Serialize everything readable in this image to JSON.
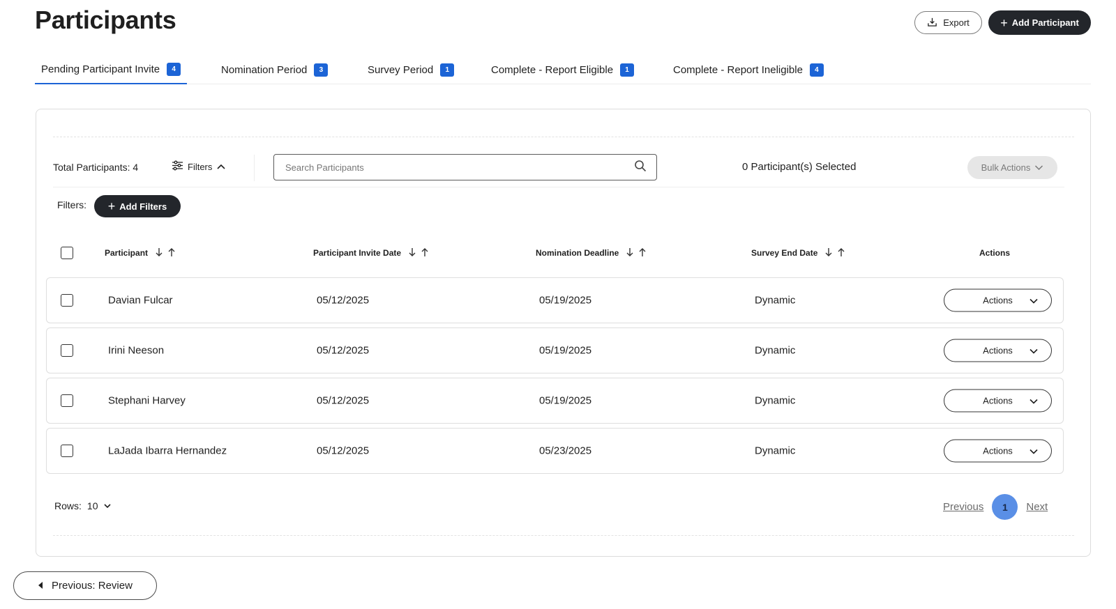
{
  "page": {
    "title": "Participants"
  },
  "header": {
    "export_label": "Export",
    "add_participant_label": "Add Participant"
  },
  "tabs": [
    {
      "label": "Pending Participant Invite",
      "count": "4",
      "active": true
    },
    {
      "label": "Nomination Period",
      "count": "3",
      "active": false
    },
    {
      "label": "Survey Period",
      "count": "1",
      "active": false
    },
    {
      "label": "Complete - Report Eligible",
      "count": "1",
      "active": false
    },
    {
      "label": "Complete - Report Ineligible",
      "count": "4",
      "active": false
    }
  ],
  "toolbar": {
    "total_label": "Total Participants: 4",
    "filters_label": "Filters",
    "search_placeholder": "Search Participants",
    "selected_label": "0 Participant(s) Selected",
    "bulk_actions_label": "Bulk Actions"
  },
  "filters_row": {
    "label": "Filters:",
    "add_filters_label": "Add Filters"
  },
  "table": {
    "columns": [
      "Participant",
      "Participant Invite Date",
      "Nomination Deadline",
      "Survey End Date",
      "Actions"
    ],
    "rows": [
      {
        "participant": "Davian Fulcar",
        "invite_date": "05/12/2025",
        "nomination_deadline": "05/19/2025",
        "survey_end": "Dynamic",
        "actions_label": "Actions"
      },
      {
        "participant": "Irini Neeson",
        "invite_date": "05/12/2025",
        "nomination_deadline": "05/19/2025",
        "survey_end": "Dynamic",
        "actions_label": "Actions"
      },
      {
        "participant": "Stephani Harvey",
        "invite_date": "05/12/2025",
        "nomination_deadline": "05/19/2025",
        "survey_end": "Dynamic",
        "actions_label": "Actions"
      },
      {
        "participant": "LaJada Ibarra Hernandez",
        "invite_date": "05/12/2025",
        "nomination_deadline": "05/23/2025",
        "survey_end": "Dynamic",
        "actions_label": "Actions"
      }
    ]
  },
  "pagination": {
    "rows_label": "Rows:",
    "rows_value": "10",
    "previous_label": "Previous",
    "current_page": "1",
    "next_label": "Next"
  },
  "footer": {
    "previous_review_label": "Previous: Review"
  },
  "colors": {
    "accent": "#1c64d6",
    "dark_button": "#23262b",
    "page_active": "#5a8fe6"
  },
  "icons": [
    "export-icon",
    "plus-icon",
    "filter-sliders-icon",
    "chevron-up-icon",
    "search-icon",
    "chevron-down-icon",
    "sort-down-icon",
    "sort-up-icon",
    "caret-left-icon"
  ]
}
